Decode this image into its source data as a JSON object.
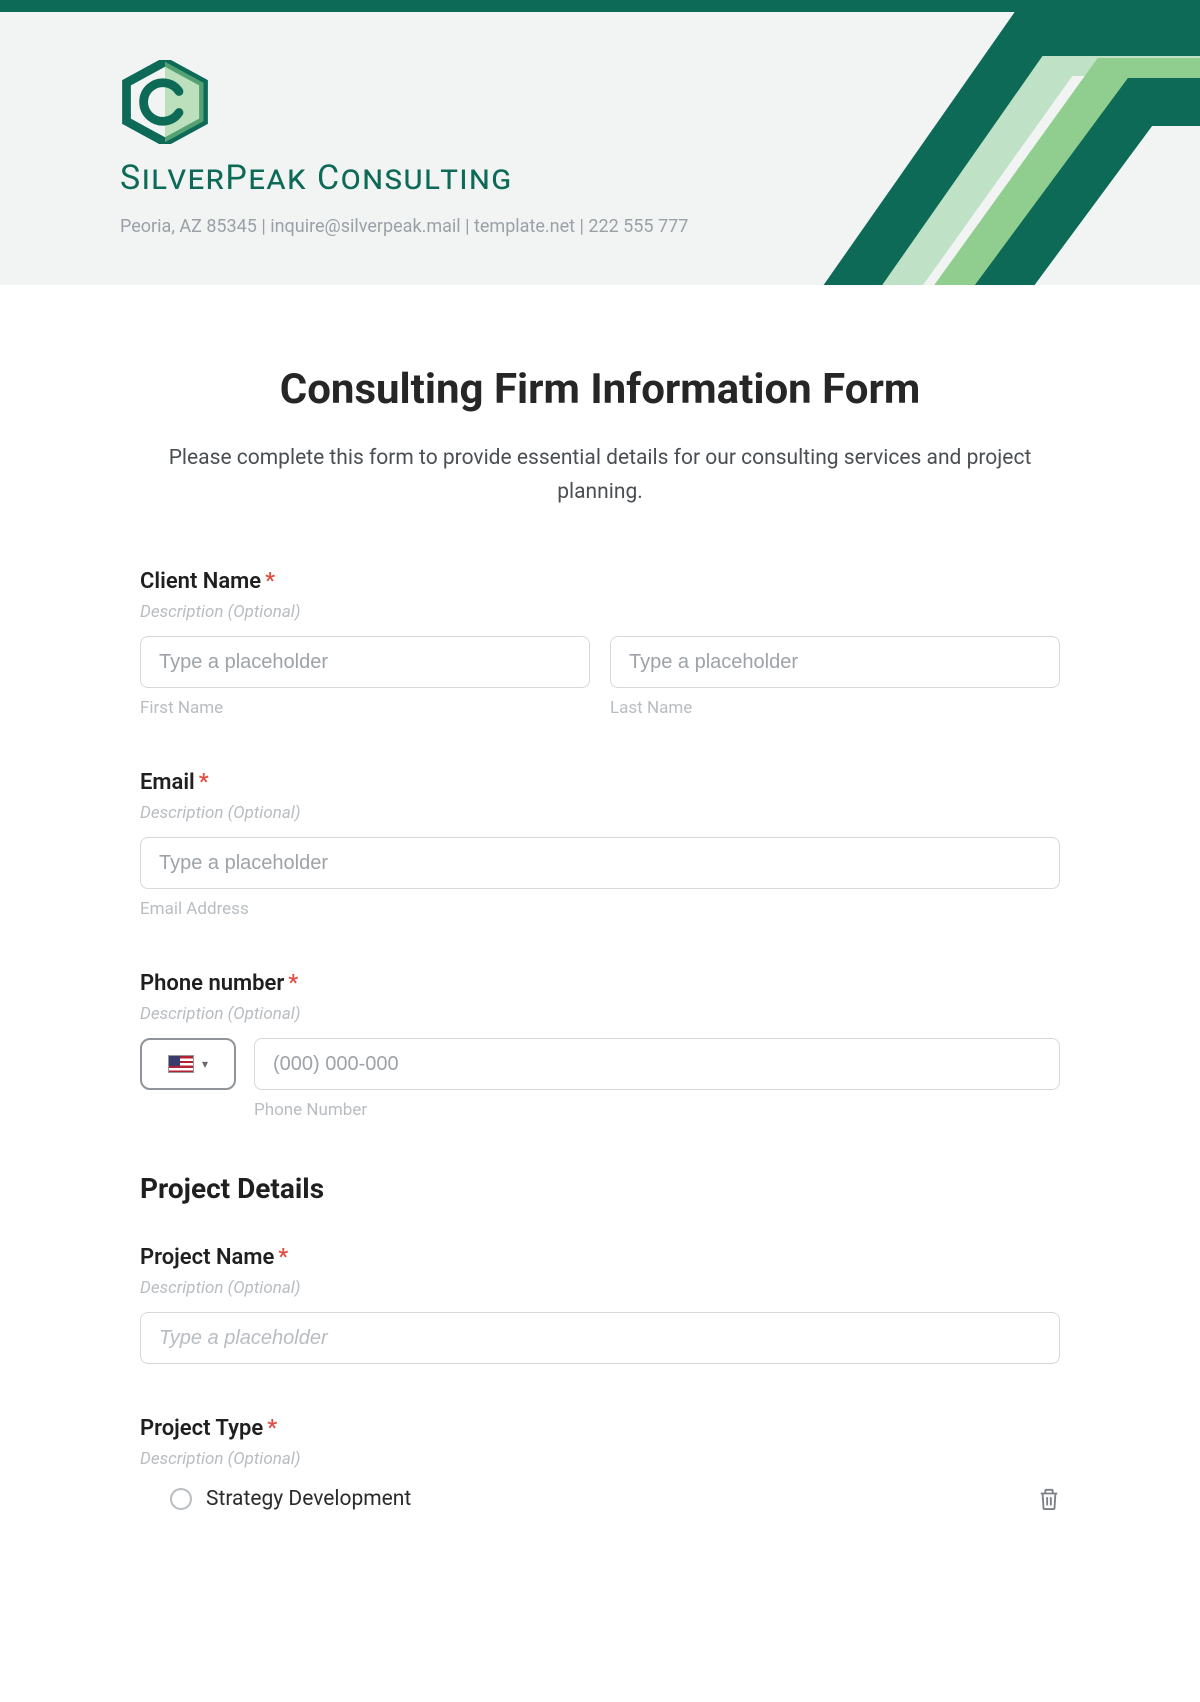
{
  "brand": {
    "name_html": "SilverPeak Consulting",
    "contact_line": "Peoria, AZ 85345 | inquire@silverpeak.mail | template.net | 222 555 777"
  },
  "form": {
    "title": "Consulting Firm Information Form",
    "intro": "Please complete this form to provide essential details for our consulting services and project planning.",
    "desc_optional": "Description (Optional)",
    "required_marker": "*",
    "client_name": {
      "label": "Client Name",
      "first_placeholder": "Type a placeholder",
      "last_placeholder": "Type a placeholder",
      "first_sub": "First Name",
      "last_sub": "Last Name"
    },
    "email": {
      "label": "Email",
      "placeholder": "Type a placeholder",
      "sub": "Email Address"
    },
    "phone": {
      "label": "Phone number",
      "placeholder": "(000) 000-000",
      "sub": "Phone Number",
      "country_icon": "flag-us",
      "dropdown_icon": "chevron-down"
    },
    "project_section_heading": "Project Details",
    "project_name": {
      "label": "Project Name",
      "placeholder": "Type a placeholder"
    },
    "project_type": {
      "label": "Project Type",
      "options": [
        "Strategy Development"
      ]
    }
  }
}
